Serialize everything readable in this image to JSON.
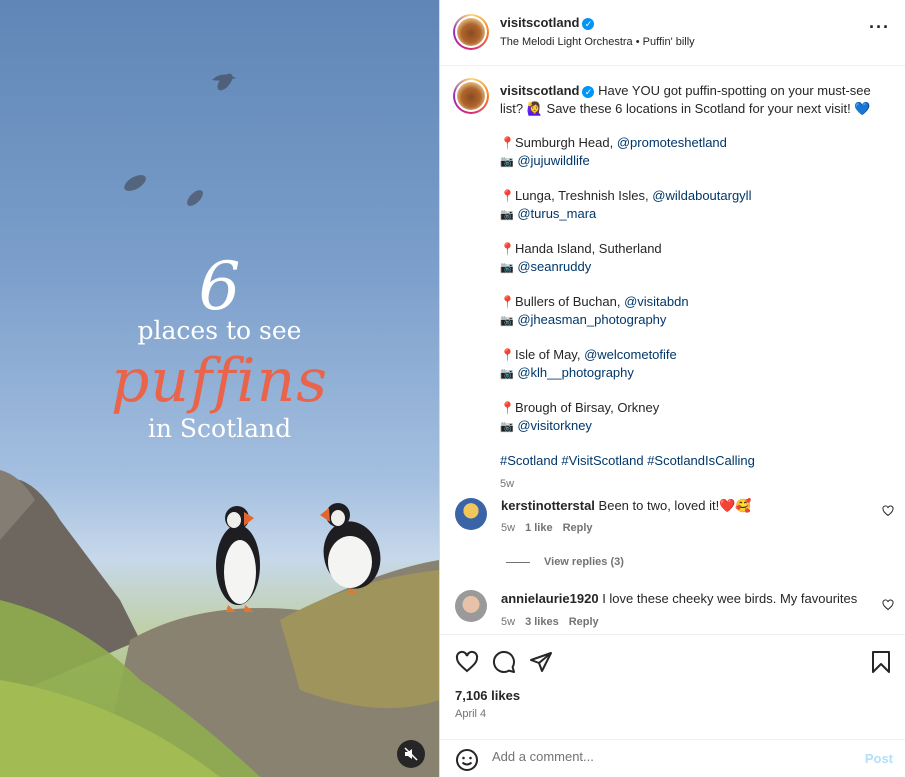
{
  "media": {
    "overlay": {
      "number": "6",
      "line1": "places to see",
      "highlight": "puffins",
      "line3": "in Scotland"
    },
    "mute_icon": "speaker-muted-icon"
  },
  "header": {
    "username": "visitscotland",
    "verified_icon": "verified-badge-icon",
    "audio": "The Melodi Light Orchestra • Puffin' billy",
    "more_icon": "more-options-icon"
  },
  "caption": {
    "username": "visitscotland",
    "intro": "Have YOU got puffin-spotting on your must-see list? 🙋‍♀️ Save these 6 locations in Scotland for your next visit! 💙",
    "locations": [
      {
        "place": "Sumburgh Head, ",
        "place_tag": "@promoteshetland",
        "photo": "@jujuwildlife"
      },
      {
        "place": "Lunga, Treshnish Isles, ",
        "place_tag": "@wildaboutargyll",
        "photo": "@turus_mara"
      },
      {
        "place": "Handa Island, Sutherland",
        "place_tag": "",
        "photo": "@seanruddy"
      },
      {
        "place": "Bullers of Buchan, ",
        "place_tag": "@visitabdn",
        "photo": "@jheasman_photography"
      },
      {
        "place": "Isle of May, ",
        "place_tag": "@welcometofife",
        "photo": "@klh__photography"
      },
      {
        "place": "Brough of Birsay, Orkney",
        "place_tag": "",
        "photo": "@visitorkney"
      }
    ],
    "pin_glyph": "📍",
    "camera_glyph": "📷",
    "hashtags": "#Scotland #VisitScotland #ScotlandIsCalling",
    "time": "5w"
  },
  "comments": [
    {
      "username": "kerstinotterstal",
      "text": "Been to two, loved it!❤️🥰",
      "time": "5w",
      "likes": "1 like",
      "reply": "Reply",
      "view_replies": "View replies (3)"
    },
    {
      "username": "annielaurie1920",
      "text": "I love these cheeky wee birds. My favourites",
      "time": "5w",
      "likes": "3 likes",
      "reply": "Reply"
    }
  ],
  "actions": {
    "like_icon": "heart-icon",
    "comment_icon": "comment-icon",
    "share_icon": "share-icon",
    "save_icon": "bookmark-icon",
    "likes": "7,106 likes",
    "date": "April 4"
  },
  "add_comment": {
    "placeholder": "Add a comment...",
    "post_label": "Post",
    "emoji_icon": "emoji-icon"
  },
  "colors": {
    "accent": "#0095f6",
    "link": "#00376b",
    "puffins_text": "#e9644a",
    "border": "#dbdbdb"
  }
}
